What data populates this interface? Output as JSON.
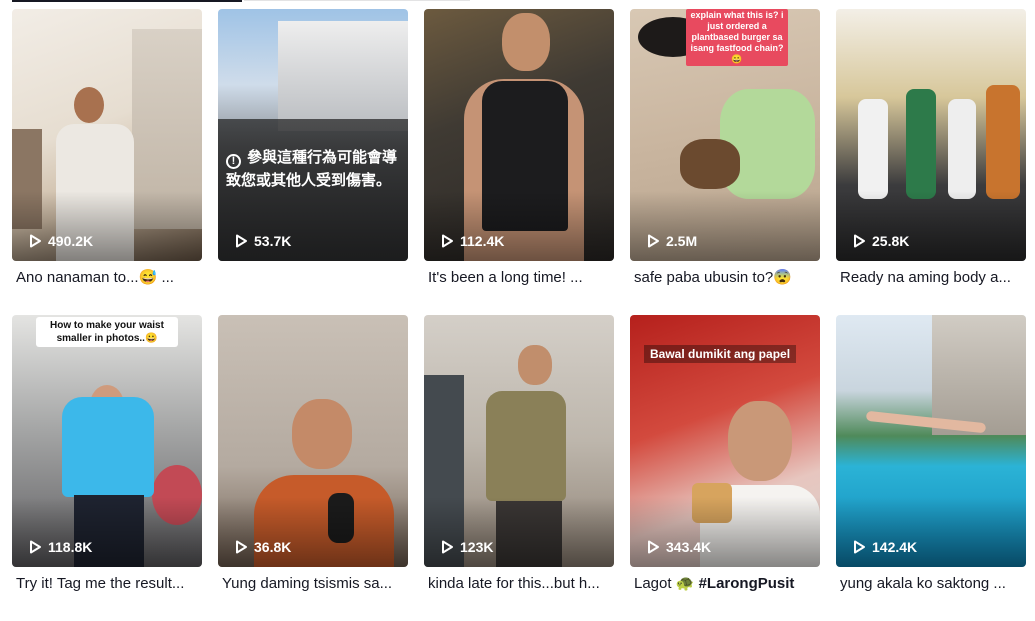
{
  "videos": [
    {
      "views": "490.2K",
      "caption": "Ano nanaman to...",
      "emoji": "😅"
    },
    {
      "views": "53.7K",
      "caption": "",
      "warning": "參與這種行為可能會導致您或其他人受到傷害。"
    },
    {
      "views": "112.4K",
      "caption": "It's been a long time! ..."
    },
    {
      "views": "2.5M",
      "caption": "safe paba ubusin to?",
      "emoji": "😨",
      "overlay": "explain what this is? i just ordered a plantbased burger sa isang fastfood chain? 😀"
    },
    {
      "views": "25.8K",
      "caption": "Ready na aming body a..."
    },
    {
      "views": "118.8K",
      "caption": "Try it! Tag me the result...",
      "overlay": "How to make your waist smaller in photos..😀"
    },
    {
      "views": "36.8K",
      "caption": "Yung daming tsismis sa..."
    },
    {
      "views": "123K",
      "caption": "kinda late for this...but h..."
    },
    {
      "views": "343.4K",
      "caption": "Lagot",
      "emoji": "🐢",
      "hashtag": "#LarongPusit",
      "overlay": "Bawal dumikit ang papel"
    },
    {
      "views": "142.4K",
      "caption": "yung akala ko saktong ..."
    }
  ],
  "colors": {
    "text": "#161823",
    "overlay_text": "#ffffff",
    "sticker_red": "#e84a5f"
  },
  "icons": {
    "play": "play-icon",
    "warning": "warning-icon"
  }
}
